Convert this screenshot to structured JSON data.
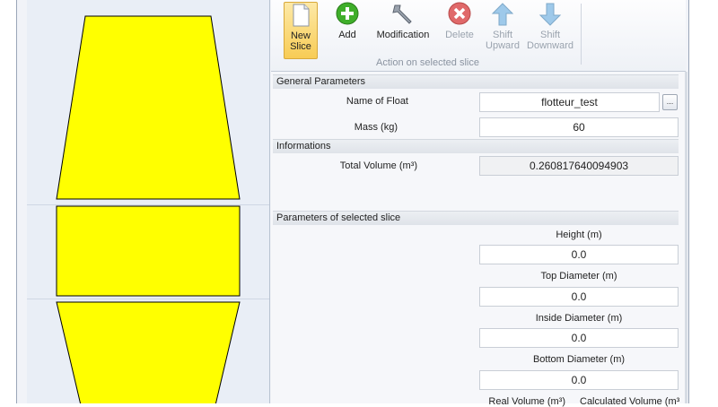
{
  "toolbar": {
    "buttons": [
      {
        "label": "New Slice",
        "icon": "new-document-icon",
        "state": "active"
      },
      {
        "label": "Add",
        "icon": "green-plus-icon",
        "state": "enabled"
      },
      {
        "label": "Modification",
        "icon": "wrench-icon",
        "state": "enabled"
      },
      {
        "label": "Delete",
        "icon": "red-x-icon",
        "state": "disabled"
      },
      {
        "label": "Shift Upward",
        "icon": "up-arrow-icon",
        "state": "disabled"
      },
      {
        "label": "Shift Downward",
        "icon": "down-arrow-icon",
        "state": "disabled"
      }
    ],
    "group_label": "Action on selected slice"
  },
  "general": {
    "title": "General Parameters",
    "name_label": "Name of Float",
    "name_value": "flotteur_test",
    "browse_label": "...",
    "mass_label": "Mass (kg)",
    "mass_value": "60"
  },
  "info": {
    "title": "Informations",
    "total_volume_label": "Total Volume (m³)",
    "total_volume_value": "0.260817640094903"
  },
  "slice": {
    "title": "Parameters of selected slice",
    "height_label": "Height (m)",
    "height_value": "0.0",
    "top_diameter_label": "Top Diameter (m)",
    "top_diameter_value": "0.0",
    "inside_diameter_label": "Inside Diameter (m)",
    "inside_diameter_value": "0.0",
    "bottom_diameter_label": "Bottom Diameter (m)",
    "bottom_diameter_value": "0.0",
    "real_volume_label": "Real Volume (m³)",
    "calculated_volume_label": "Calculated Volume (m³"
  },
  "colors": {
    "slice_fill": "#ffff00",
    "slice_stroke": "#000000",
    "new_slice_active": "#f8cc55"
  }
}
